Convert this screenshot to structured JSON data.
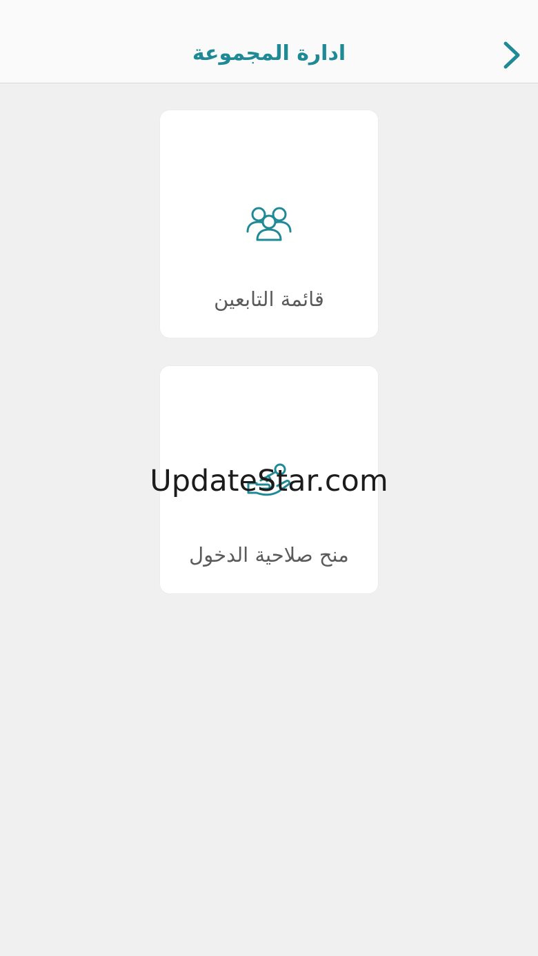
{
  "header": {
    "title": "ادارة المجموعة",
    "back_icon": "chevron-right-icon",
    "accent_color": "#1f8a96"
  },
  "cards": [
    {
      "label": "قائمة التابعين",
      "icon": "people-group-icon"
    },
    {
      "label": "منح صلاحية الدخول",
      "icon": "hand-with-key-icon"
    }
  ],
  "watermark": "UpdateStar.com",
  "colors": {
    "background": "#f0f0f0",
    "card": "#ffffff",
    "label_text": "#5a5a5a"
  }
}
